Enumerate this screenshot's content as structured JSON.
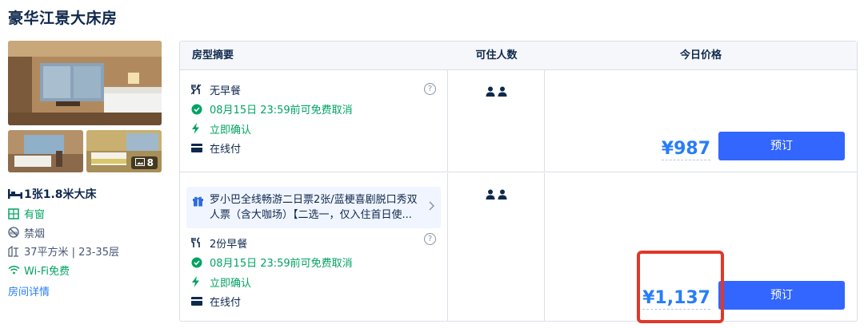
{
  "room": {
    "title": "豪华江景大床房",
    "photo_count": "8",
    "facilities": {
      "bed": "1张1.8米大床",
      "window": "有窗",
      "smoking": "禁烟",
      "area": "37平方米 | 23-35层",
      "wifi": "Wi-Fi免费"
    },
    "detail_link": "房间详情"
  },
  "table": {
    "headers": [
      "房型摘要",
      "可住人数",
      "今日价格"
    ],
    "rows": [
      {
        "meal": "无早餐",
        "cancel": "08月15日 23:59前可免费取消",
        "confirm": "立即确认",
        "payment": "在线付",
        "price": "¥987",
        "book_label": "预订"
      },
      {
        "package": "罗小巴全线畅游二日票2张/蓝梗喜剧脱口秀双人票（含大咖场）【二选一，仅入住首日使...",
        "meal": "2份早餐",
        "cancel": "08月15日 23:59前可免费取消",
        "confirm": "立即确认",
        "payment": "在线付",
        "price": "¥1,137",
        "book_label": "预订"
      }
    ]
  },
  "colors": {
    "accent": "#3366ff",
    "price": "#287dfa",
    "green": "#00a363",
    "highlight": "#e1382a"
  },
  "icons": [
    "bed-icon",
    "window-icon",
    "no-smoking-icon",
    "area-icon",
    "wifi-icon",
    "cutlery-icon",
    "check-circle-icon",
    "bolt-icon",
    "card-icon",
    "help-icon",
    "guest-icon",
    "gift-icon",
    "chevron-right-icon",
    "gallery-icon"
  ]
}
